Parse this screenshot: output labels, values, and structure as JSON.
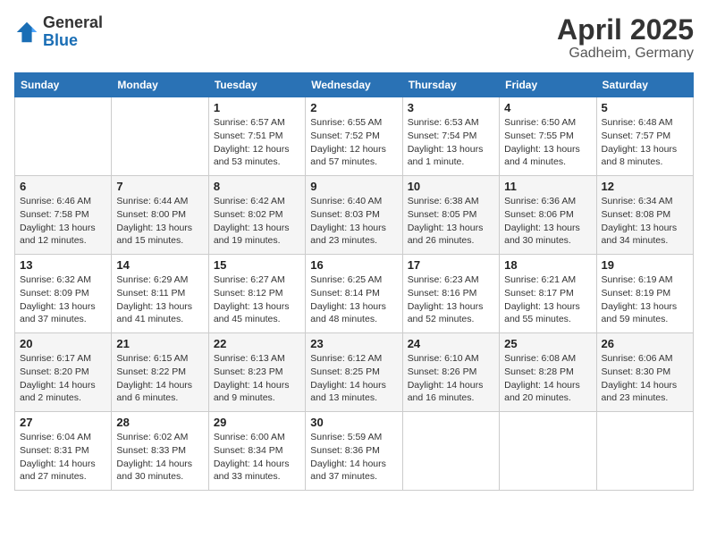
{
  "header": {
    "logo_general": "General",
    "logo_blue": "Blue",
    "month_title": "April 2025",
    "location": "Gadheim, Germany"
  },
  "days_of_week": [
    "Sunday",
    "Monday",
    "Tuesday",
    "Wednesday",
    "Thursday",
    "Friday",
    "Saturday"
  ],
  "weeks": [
    [
      {
        "day": "",
        "sunrise": "",
        "sunset": "",
        "daylight": ""
      },
      {
        "day": "",
        "sunrise": "",
        "sunset": "",
        "daylight": ""
      },
      {
        "day": "1",
        "sunrise": "Sunrise: 6:57 AM",
        "sunset": "Sunset: 7:51 PM",
        "daylight": "Daylight: 12 hours and 53 minutes."
      },
      {
        "day": "2",
        "sunrise": "Sunrise: 6:55 AM",
        "sunset": "Sunset: 7:52 PM",
        "daylight": "Daylight: 12 hours and 57 minutes."
      },
      {
        "day": "3",
        "sunrise": "Sunrise: 6:53 AM",
        "sunset": "Sunset: 7:54 PM",
        "daylight": "Daylight: 13 hours and 1 minute."
      },
      {
        "day": "4",
        "sunrise": "Sunrise: 6:50 AM",
        "sunset": "Sunset: 7:55 PM",
        "daylight": "Daylight: 13 hours and 4 minutes."
      },
      {
        "day": "5",
        "sunrise": "Sunrise: 6:48 AM",
        "sunset": "Sunset: 7:57 PM",
        "daylight": "Daylight: 13 hours and 8 minutes."
      }
    ],
    [
      {
        "day": "6",
        "sunrise": "Sunrise: 6:46 AM",
        "sunset": "Sunset: 7:58 PM",
        "daylight": "Daylight: 13 hours and 12 minutes."
      },
      {
        "day": "7",
        "sunrise": "Sunrise: 6:44 AM",
        "sunset": "Sunset: 8:00 PM",
        "daylight": "Daylight: 13 hours and 15 minutes."
      },
      {
        "day": "8",
        "sunrise": "Sunrise: 6:42 AM",
        "sunset": "Sunset: 8:02 PM",
        "daylight": "Daylight: 13 hours and 19 minutes."
      },
      {
        "day": "9",
        "sunrise": "Sunrise: 6:40 AM",
        "sunset": "Sunset: 8:03 PM",
        "daylight": "Daylight: 13 hours and 23 minutes."
      },
      {
        "day": "10",
        "sunrise": "Sunrise: 6:38 AM",
        "sunset": "Sunset: 8:05 PM",
        "daylight": "Daylight: 13 hours and 26 minutes."
      },
      {
        "day": "11",
        "sunrise": "Sunrise: 6:36 AM",
        "sunset": "Sunset: 8:06 PM",
        "daylight": "Daylight: 13 hours and 30 minutes."
      },
      {
        "day": "12",
        "sunrise": "Sunrise: 6:34 AM",
        "sunset": "Sunset: 8:08 PM",
        "daylight": "Daylight: 13 hours and 34 minutes."
      }
    ],
    [
      {
        "day": "13",
        "sunrise": "Sunrise: 6:32 AM",
        "sunset": "Sunset: 8:09 PM",
        "daylight": "Daylight: 13 hours and 37 minutes."
      },
      {
        "day": "14",
        "sunrise": "Sunrise: 6:29 AM",
        "sunset": "Sunset: 8:11 PM",
        "daylight": "Daylight: 13 hours and 41 minutes."
      },
      {
        "day": "15",
        "sunrise": "Sunrise: 6:27 AM",
        "sunset": "Sunset: 8:12 PM",
        "daylight": "Daylight: 13 hours and 45 minutes."
      },
      {
        "day": "16",
        "sunrise": "Sunrise: 6:25 AM",
        "sunset": "Sunset: 8:14 PM",
        "daylight": "Daylight: 13 hours and 48 minutes."
      },
      {
        "day": "17",
        "sunrise": "Sunrise: 6:23 AM",
        "sunset": "Sunset: 8:16 PM",
        "daylight": "Daylight: 13 hours and 52 minutes."
      },
      {
        "day": "18",
        "sunrise": "Sunrise: 6:21 AM",
        "sunset": "Sunset: 8:17 PM",
        "daylight": "Daylight: 13 hours and 55 minutes."
      },
      {
        "day": "19",
        "sunrise": "Sunrise: 6:19 AM",
        "sunset": "Sunset: 8:19 PM",
        "daylight": "Daylight: 13 hours and 59 minutes."
      }
    ],
    [
      {
        "day": "20",
        "sunrise": "Sunrise: 6:17 AM",
        "sunset": "Sunset: 8:20 PM",
        "daylight": "Daylight: 14 hours and 2 minutes."
      },
      {
        "day": "21",
        "sunrise": "Sunrise: 6:15 AM",
        "sunset": "Sunset: 8:22 PM",
        "daylight": "Daylight: 14 hours and 6 minutes."
      },
      {
        "day": "22",
        "sunrise": "Sunrise: 6:13 AM",
        "sunset": "Sunset: 8:23 PM",
        "daylight": "Daylight: 14 hours and 9 minutes."
      },
      {
        "day": "23",
        "sunrise": "Sunrise: 6:12 AM",
        "sunset": "Sunset: 8:25 PM",
        "daylight": "Daylight: 14 hours and 13 minutes."
      },
      {
        "day": "24",
        "sunrise": "Sunrise: 6:10 AM",
        "sunset": "Sunset: 8:26 PM",
        "daylight": "Daylight: 14 hours and 16 minutes."
      },
      {
        "day": "25",
        "sunrise": "Sunrise: 6:08 AM",
        "sunset": "Sunset: 8:28 PM",
        "daylight": "Daylight: 14 hours and 20 minutes."
      },
      {
        "day": "26",
        "sunrise": "Sunrise: 6:06 AM",
        "sunset": "Sunset: 8:30 PM",
        "daylight": "Daylight: 14 hours and 23 minutes."
      }
    ],
    [
      {
        "day": "27",
        "sunrise": "Sunrise: 6:04 AM",
        "sunset": "Sunset: 8:31 PM",
        "daylight": "Daylight: 14 hours and 27 minutes."
      },
      {
        "day": "28",
        "sunrise": "Sunrise: 6:02 AM",
        "sunset": "Sunset: 8:33 PM",
        "daylight": "Daylight: 14 hours and 30 minutes."
      },
      {
        "day": "29",
        "sunrise": "Sunrise: 6:00 AM",
        "sunset": "Sunset: 8:34 PM",
        "daylight": "Daylight: 14 hours and 33 minutes."
      },
      {
        "day": "30",
        "sunrise": "Sunrise: 5:59 AM",
        "sunset": "Sunset: 8:36 PM",
        "daylight": "Daylight: 14 hours and 37 minutes."
      },
      {
        "day": "",
        "sunrise": "",
        "sunset": "",
        "daylight": ""
      },
      {
        "day": "",
        "sunrise": "",
        "sunset": "",
        "daylight": ""
      },
      {
        "day": "",
        "sunrise": "",
        "sunset": "",
        "daylight": ""
      }
    ]
  ]
}
